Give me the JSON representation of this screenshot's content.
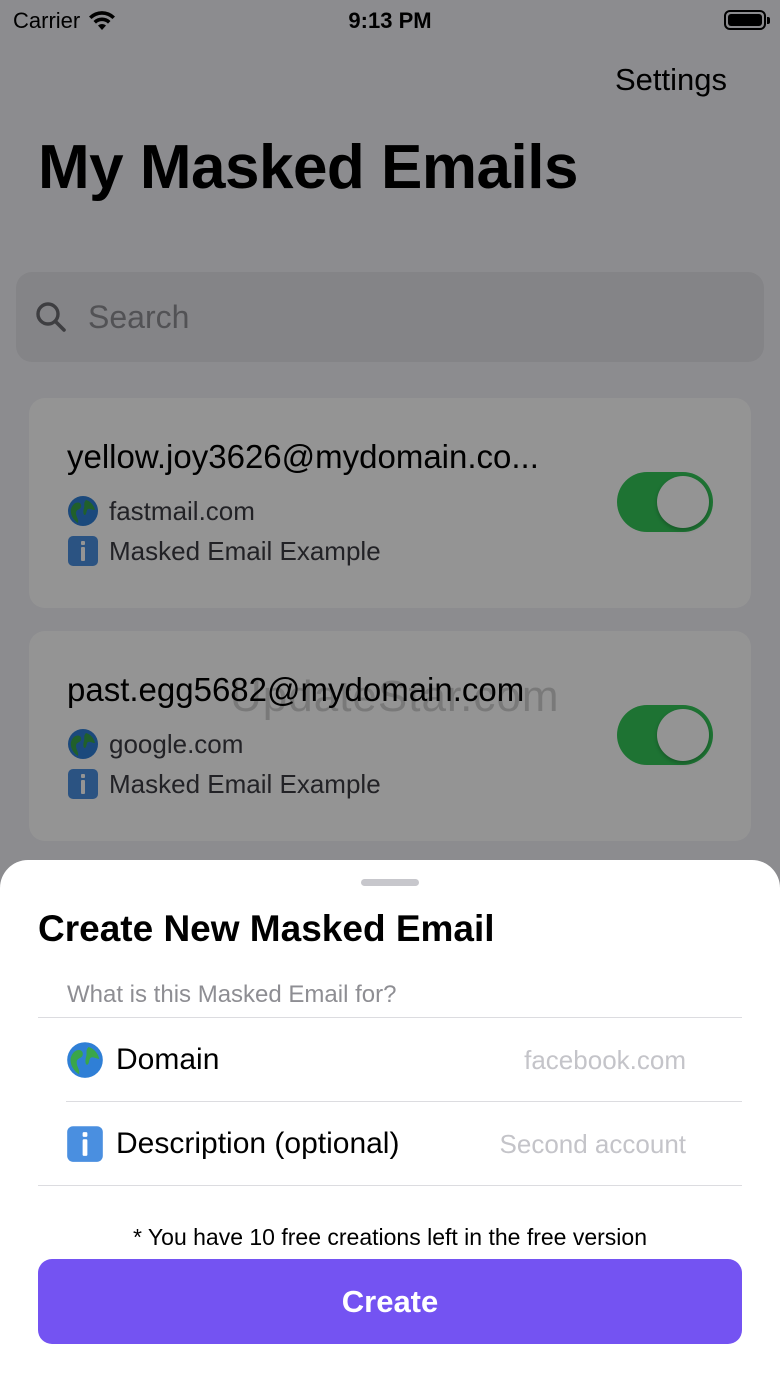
{
  "status_bar": {
    "carrier": "Carrier",
    "time": "9:13 PM",
    "wifi_icon": "wifi-icon",
    "battery_icon": "battery-icon"
  },
  "nav": {
    "settings_label": "Settings",
    "title": "My Masked Emails"
  },
  "search": {
    "placeholder": "Search",
    "icon": "search-icon"
  },
  "emails": [
    {
      "address": "yellow.joy3626@mydomain.co...",
      "domain": "fastmail.com",
      "description": "Masked Email Example",
      "enabled": true
    },
    {
      "address": "past.egg5682@mydomain.com",
      "domain": "google.com",
      "description": "Masked Email Example",
      "enabled": true
    }
  ],
  "watermark": "UpdateStar.com",
  "sheet": {
    "title": "Create New Masked Email",
    "section_header": "What is this Masked Email for?",
    "domain_label": "Domain",
    "domain_placeholder": "facebook.com",
    "description_label": "Description (optional)",
    "description_placeholder": "Second account",
    "free_note": "* You have 10 free creations left in the free version",
    "create_label": "Create"
  },
  "colors": {
    "accent": "#7453f2",
    "toggle_on": "#34c759",
    "globe_blue": "#2f7fd6",
    "globe_green": "#3aa64a",
    "info_blue": "#4a8fe0"
  }
}
